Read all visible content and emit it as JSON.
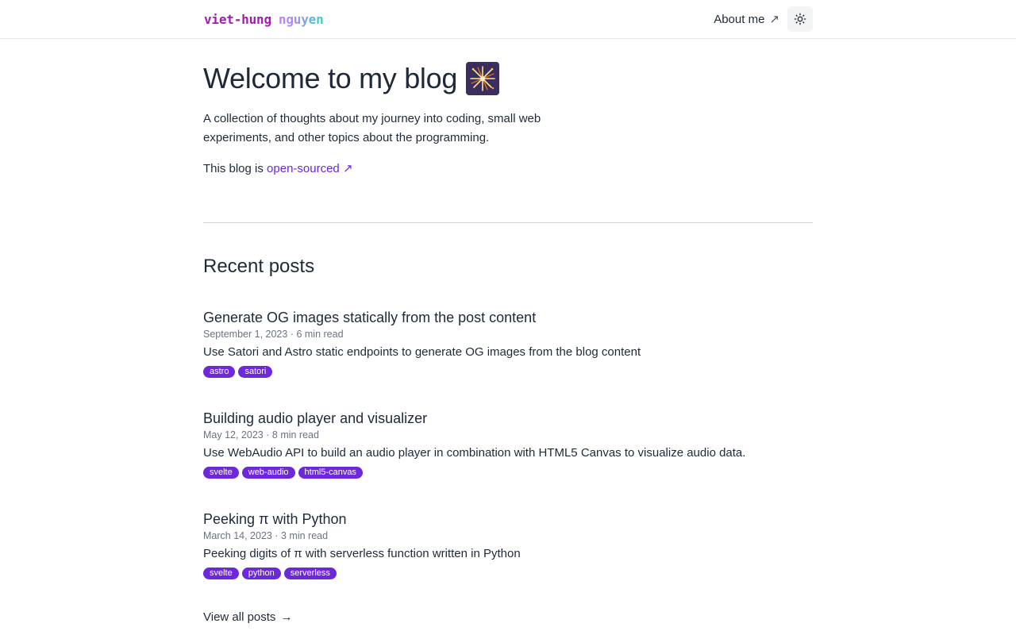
{
  "header": {
    "logo_first": "viet-hung",
    "logo_last": "nguyen",
    "about_label": "About me",
    "about_icon": "↗",
    "theme_icon": "sun-icon"
  },
  "hero": {
    "title": "Welcome to my blog",
    "emoji": "🎇",
    "intro": "A collection of thoughts about my journey into coding, small web experiments, and other topics about the programming.",
    "oss_prefix": "This blog is",
    "oss_link": "open-sourced",
    "oss_icon": "↗"
  },
  "recent": {
    "title": "Recent posts",
    "posts": [
      {
        "title": "Generate OG images statically from the post content",
        "date": "September 1, 2023",
        "read_time": "6 min read",
        "description": "Use Satori and Astro static endpoints to generate OG images from the blog content",
        "tags": [
          "astro",
          "satori"
        ]
      },
      {
        "title": "Building audio player and visualizer",
        "date": "May 12, 2023",
        "read_time": "8 min read",
        "description": "Use WebAudio API to build an audio player in combination with HTML5 Canvas to visualize audio data.",
        "tags": [
          "svelte",
          "web-audio",
          "html5-canvas"
        ]
      },
      {
        "title": "Peeking π with Python",
        "date": "March 14, 2023",
        "read_time": "3 min read",
        "description": "Peeking digits of π with serverless function written in Python",
        "tags": [
          "svelte",
          "python",
          "serverless"
        ]
      }
    ],
    "meta_separator": "·",
    "view_all_label": "View all posts",
    "view_all_icon": "→"
  },
  "colors": {
    "accent": "#6d28d9",
    "text": "#1f2937",
    "muted": "#6b7280"
  }
}
